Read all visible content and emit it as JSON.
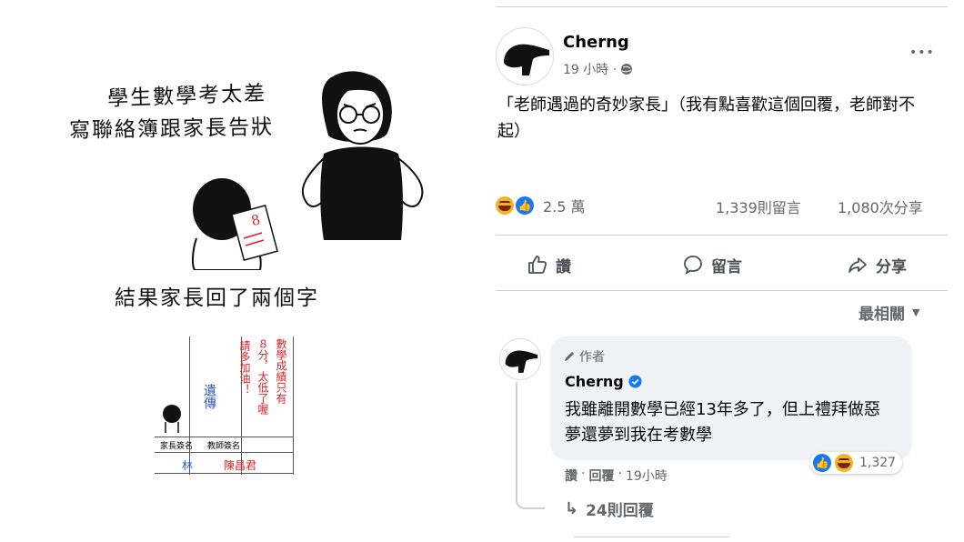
{
  "comic": {
    "line1": "學生數學考太差",
    "line2": "寫聯絡簿跟家長告狀",
    "line3": "結果家長回了兩個字",
    "red_note_col1": "請多加油！",
    "red_note_col2": "８分，太低了喔",
    "red_note_col3": "數學成績只有",
    "blue_note": "遺傳",
    "label_parent": "家長簽名",
    "label_teacher": "教師簽名",
    "sign_parent": "林",
    "sign_teacher": "陳昌君",
    "score_mark": "8"
  },
  "post": {
    "author": "Cherng",
    "time": "19 小時 ·",
    "text": "「老師遇過的奇妙家長」（我有點喜歡這個回覆，老師對不起）",
    "reaction_count": "2.5 萬",
    "comment_count": "1,339則留言",
    "share_count": "1,080次分享",
    "more": "•••"
  },
  "actions": {
    "like": "讚",
    "comment": "留言",
    "share": "分享"
  },
  "sort": {
    "label": "最相關",
    "arrow": "▼"
  },
  "comment": {
    "badge": "作者",
    "author": "Cherng",
    "text": "我雖離開數學已經13年多了，但上禮拜做惡夢還夢到我在考數學",
    "reactions": "1,327",
    "like": "讚",
    "reply": "回覆",
    "time": "19小時",
    "sep": "·",
    "replies": "24則回覆",
    "replies_arrow": "↳"
  }
}
